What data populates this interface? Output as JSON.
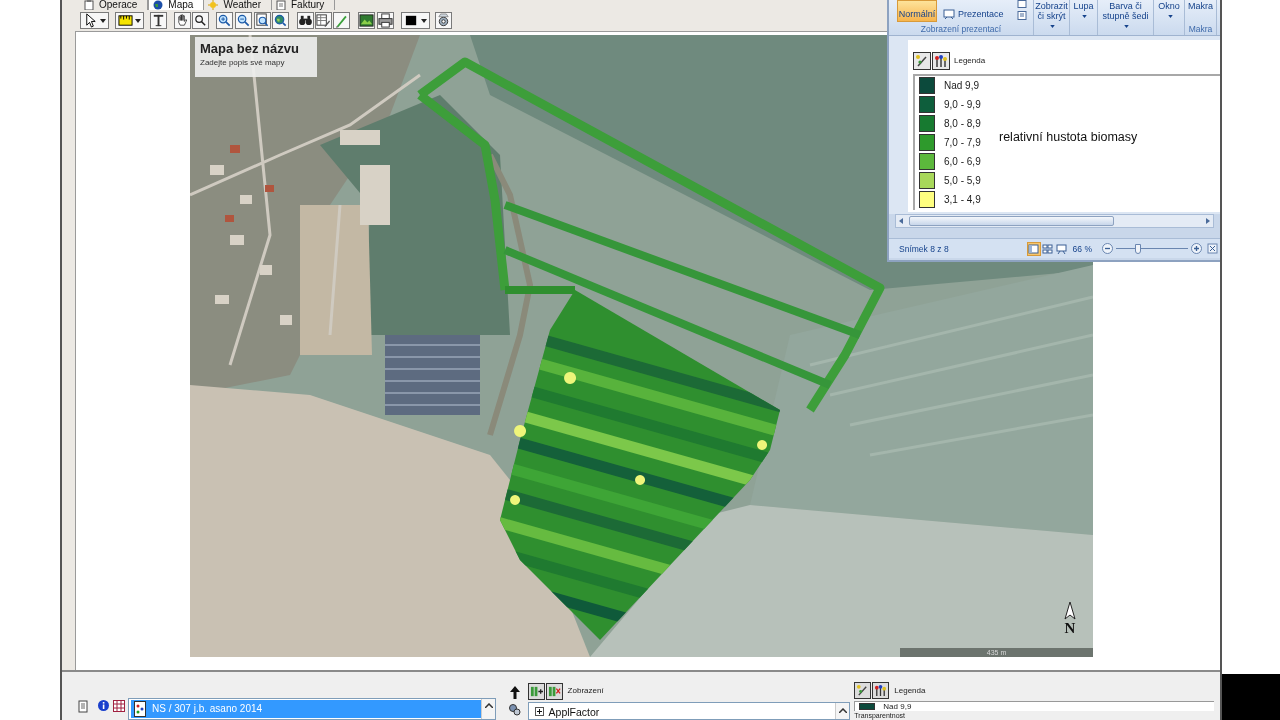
{
  "app_tabs": [
    {
      "label": "Operace",
      "selected": false
    },
    {
      "label": "Mapa",
      "selected": true
    },
    {
      "label": "Weather",
      "selected": false
    },
    {
      "label": "Faktury",
      "selected": false
    }
  ],
  "map": {
    "title": "Mapa bez názvu",
    "description": "Zadejte popis své mapy",
    "north_label": "N",
    "scale_label": "435 m"
  },
  "presentation_window": {
    "ribbon": {
      "view_group": {
        "label": "Zobrazení prezentací",
        "buttons": [
          {
            "kind": "large",
            "label": "Normální",
            "selected": true
          },
          {
            "kind": "small",
            "label": "Prezentace",
            "selected": false
          }
        ]
      },
      "menus": [
        {
          "label": "Zobrazit či skrýt",
          "dropdown": true
        },
        {
          "label": "Lupa",
          "dropdown": true
        },
        {
          "label": "Barva či stupně šedi",
          "dropdown": true
        },
        {
          "label": "Okno",
          "dropdown": true
        },
        {
          "label": "Makra",
          "dropdown": false,
          "group_label": "Makra"
        }
      ]
    },
    "slide": {
      "legend_title": "Legenda",
      "legend_items": [
        {
          "label": "Nad 9,9",
          "color": "#0c4a3c"
        },
        {
          "label": "9,0 - 9,9",
          "color": "#0e5e3c"
        },
        {
          "label": "8,0 - 8,9",
          "color": "#177a30"
        },
        {
          "label": "7,0 - 7,9",
          "color": "#2e9a2c"
        },
        {
          "label": "6,0 - 6,9",
          "color": "#5cb83c"
        },
        {
          "label": "5,0 - 5,9",
          "color": "#a8d85a"
        },
        {
          "label": "3,1 - 4,9",
          "color": "#ffff80"
        }
      ],
      "caption": "relativní hustota biomasy"
    },
    "status_bar": {
      "slide_counter": "Snímek 8 z 8",
      "views": [
        {
          "selected": true
        },
        {
          "selected": false
        },
        {
          "selected": false
        }
      ],
      "zoom_label": "66 %",
      "zoom": {
        "level": 0.3
      }
    }
  },
  "bottom_panels": {
    "layers": {
      "items": [
        {
          "label": "NS / 307 j.b. asano 2014",
          "selected": true
        }
      ]
    },
    "display": {
      "title": "Zobrazení",
      "tree": [
        {
          "label": "ApplFactor",
          "expanded": false
        }
      ]
    },
    "legend": {
      "title": "Legenda",
      "items": [
        {
          "label": "Nad 9,9",
          "color": "#0c4a3c"
        }
      ],
      "transparency_label": "Transparentnost"
    }
  }
}
